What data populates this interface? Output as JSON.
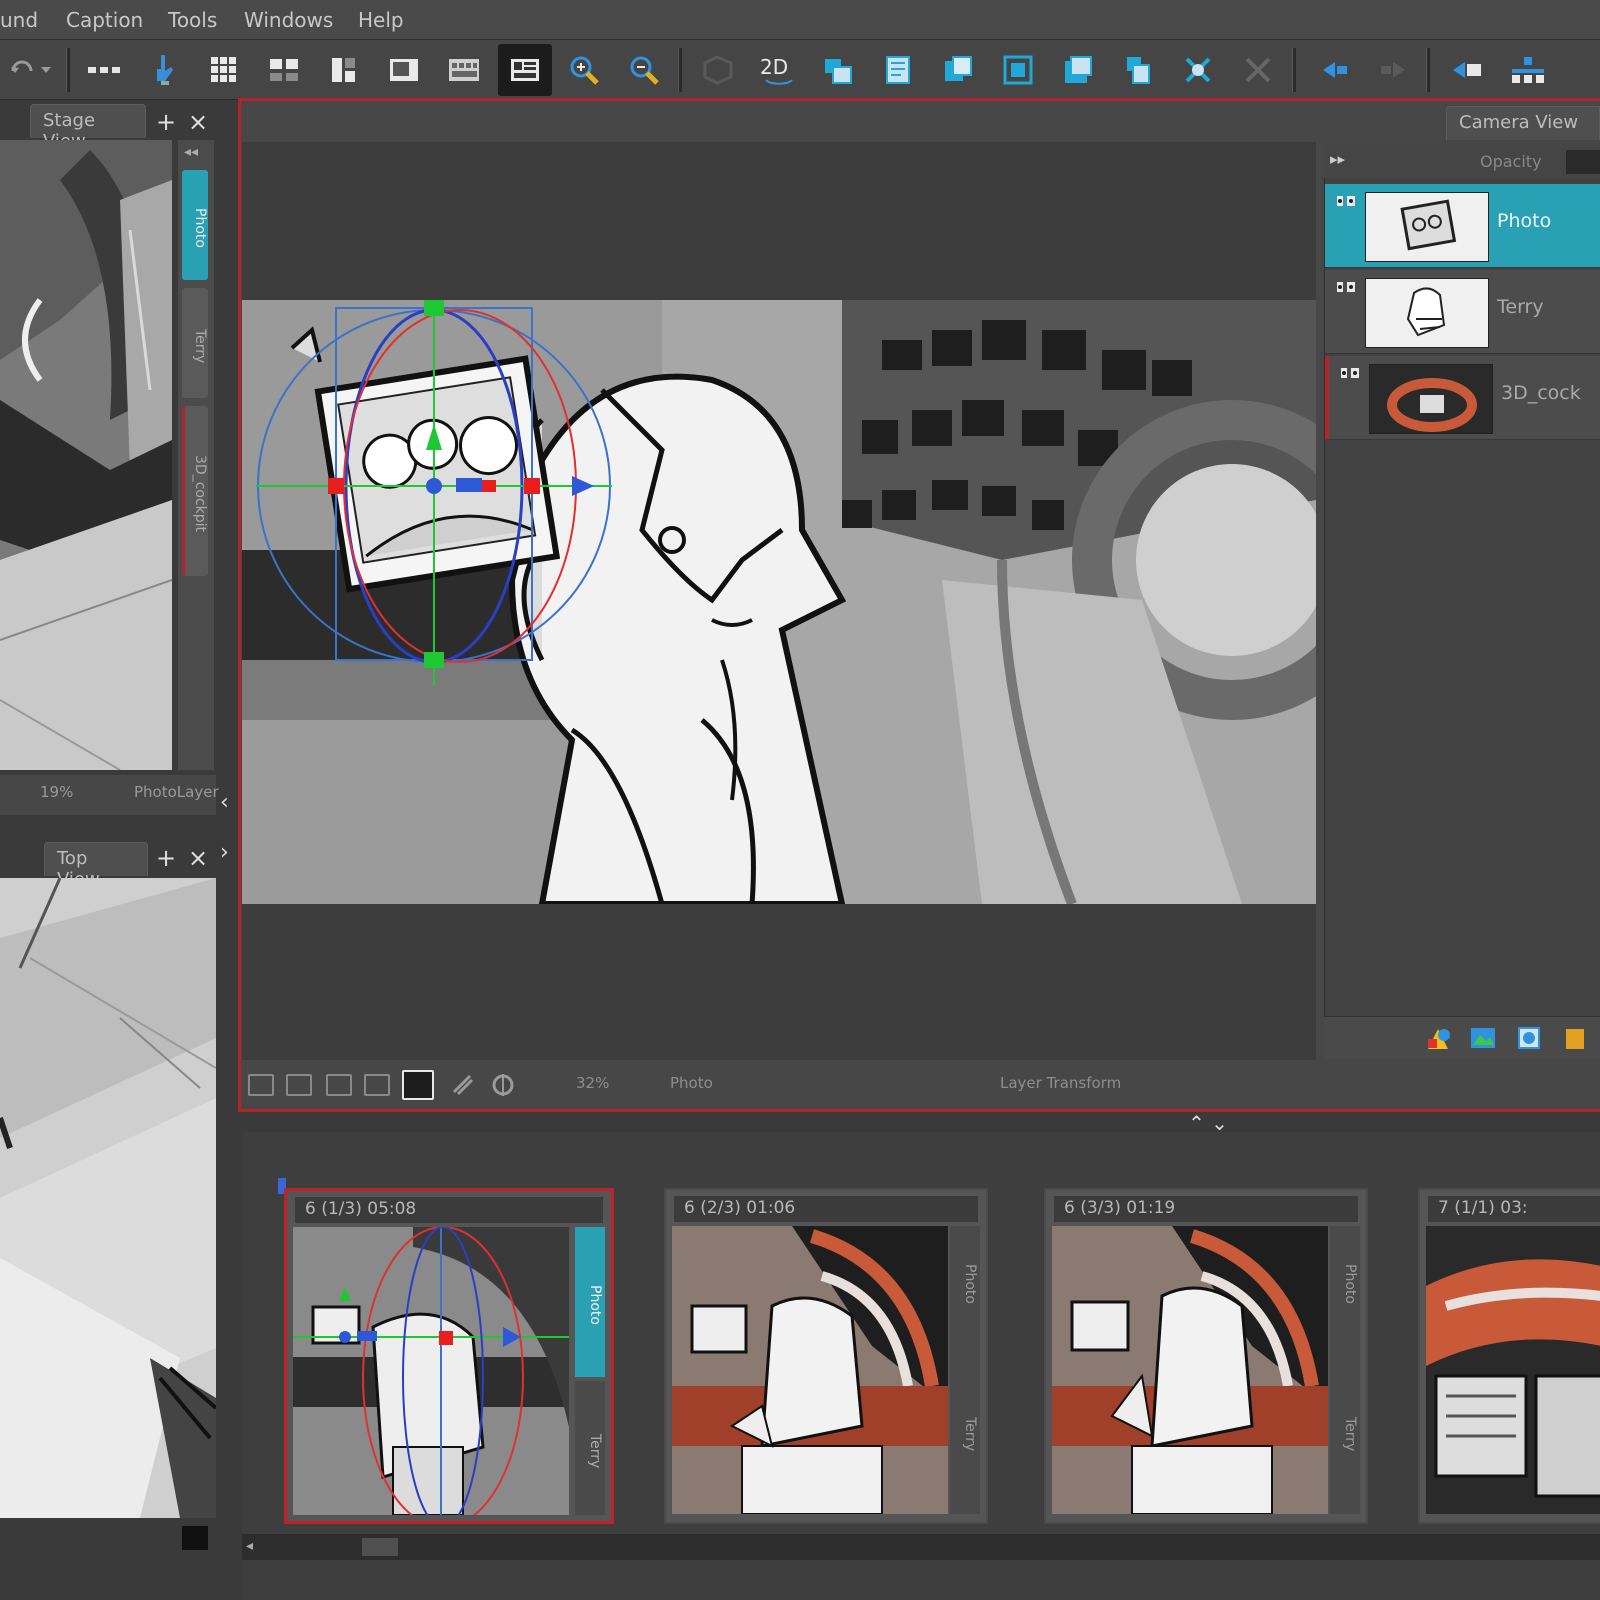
{
  "menu": {
    "items": [
      "und",
      "Caption",
      "Tools",
      "Windows",
      "Help"
    ]
  },
  "toolbar": {
    "icons": [
      "undo-icon",
      "dropdown-icon",
      "more-icon",
      "hand-icon",
      "grid-icon",
      "layout-icon",
      "split-icon",
      "single-view-icon",
      "thumbnails-icon",
      "timeline-view-icon",
      "zoom-in-icon",
      "zoom-out-icon",
      "3d-icon",
      "2d-icon",
      "layer-a-icon",
      "layer-b-icon",
      "layer-c-icon",
      "layer-d-icon",
      "layer-e-icon",
      "layer-f-icon",
      "flip-icon",
      "lock-icon",
      "prev-icon",
      "next-icon",
      "first-icon",
      "split-panel-icon"
    ],
    "twod_label": "2D"
  },
  "stage_view": {
    "tab_label": "Stage View",
    "zoom": "19%",
    "layer": "PhotoLayer",
    "side_layers": [
      "Photo",
      "Terry",
      "3D_cockpit"
    ]
  },
  "top_view": {
    "tab_label": "Top View"
  },
  "camera_view": {
    "tab_label": "Camera View",
    "opacity_label": "Opacity",
    "zoom": "32%",
    "layer": "Photo",
    "tool": "Layer Transform"
  },
  "layers": [
    {
      "name": "Photo",
      "selected": true
    },
    {
      "name": "Terry",
      "selected": false
    },
    {
      "name": "3D_cock",
      "selected": false
    }
  ],
  "panels": [
    {
      "label": "6 (1/3) 05:08",
      "selected": true
    },
    {
      "label": "6 (2/3) 01:06",
      "selected": false
    },
    {
      "label": "6 (3/3) 01:19",
      "selected": false
    },
    {
      "label": "7 (1/1) 03:",
      "selected": false
    }
  ],
  "panel_side_labels": [
    "Photo",
    "Terry"
  ],
  "colors": {
    "accent_red": "#b3232b",
    "selection_teal": "#2aa0b4",
    "manip_green": "#1ec832",
    "manip_red": "#e81e1e",
    "manip_blue": "#2e58d6"
  }
}
